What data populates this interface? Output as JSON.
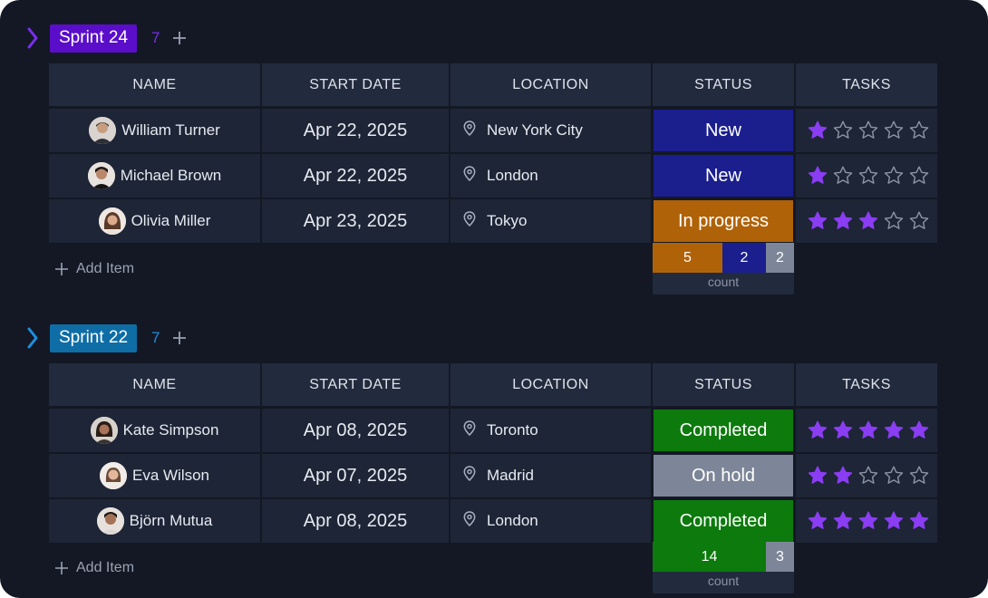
{
  "colors": {
    "background": "#131824",
    "cell": "#1d2536",
    "header_cell": "#222b3d",
    "sprint24_pill": "#5a0ec9",
    "sprint24_accent": "#7a2ef0",
    "sprint22_pill": "#0f6da6",
    "sprint22_accent": "#1e8ee0",
    "status_new": "#1b1f8e",
    "status_in_progress": "#b06208",
    "status_completed": "#0d7a0d",
    "status_on_hold": "#7d8698",
    "star_filled": "#8a3df2"
  },
  "columns": [
    "NAME",
    "START DATE",
    "LOCATION",
    "STATUS",
    "TASKS"
  ],
  "add_item_label": "Add Item",
  "count_label": "count",
  "groups": [
    {
      "title": "Sprint 24",
      "count": "7",
      "rows": [
        {
          "name": "William Turner",
          "date": "Apr 22, 2025",
          "location": "New York City",
          "status": "New",
          "status_key": "status_new",
          "tasks": 1
        },
        {
          "name": "Michael Brown",
          "date": "Apr 22, 2025",
          "location": "London",
          "status": "New",
          "status_key": "status_new",
          "tasks": 1
        },
        {
          "name": "Olivia Miller",
          "date": "Apr 23, 2025",
          "location": "Tokyo",
          "status": "In progress",
          "status_key": "status_in_progress",
          "tasks": 3
        }
      ],
      "summary": [
        {
          "value": "5",
          "color_key": "status_in_progress"
        },
        {
          "value": "2",
          "color_key": "status_new"
        },
        {
          "value": "2",
          "color_key": "status_on_hold"
        }
      ]
    },
    {
      "title": "Sprint 22",
      "count": "7",
      "rows": [
        {
          "name": "Kate Simpson",
          "date": "Apr 08, 2025",
          "location": "Toronto",
          "status": "Completed",
          "status_key": "status_completed",
          "tasks": 5
        },
        {
          "name": "Eva Wilson",
          "date": "Apr 07, 2025",
          "location": "Madrid",
          "status": "On hold",
          "status_key": "status_on_hold",
          "tasks": 2
        },
        {
          "name": "Björn Mutua",
          "date": "Apr 08, 2025",
          "location": "London",
          "status": "Completed",
          "status_key": "status_completed",
          "tasks": 5
        }
      ],
      "summary": [
        {
          "value": "14",
          "color_key": "status_completed"
        },
        {
          "value": "3",
          "color_key": "status_on_hold"
        }
      ]
    }
  ]
}
